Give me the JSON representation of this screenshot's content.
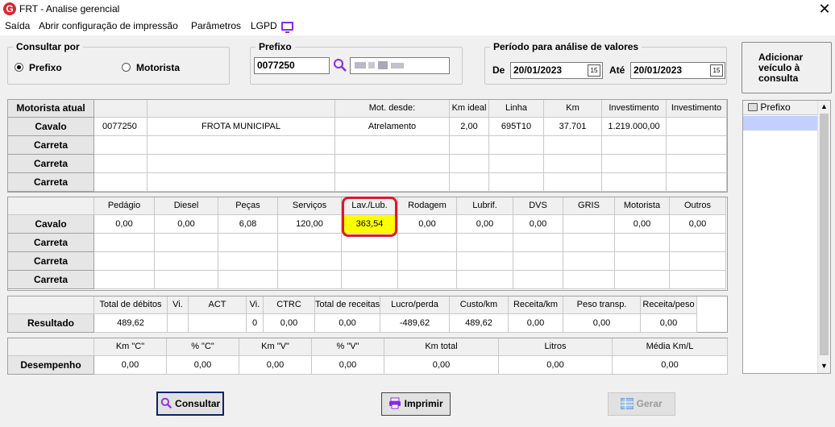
{
  "window": {
    "title": "FRT - Analise gerencial",
    "logo": "G"
  },
  "menu": [
    "Saída",
    "Abrir configuração de impressão",
    "Parâmetros",
    "LGPD"
  ],
  "consultar": {
    "legend": "Consultar por",
    "opt1": "Prefixo",
    "opt2": "Motorista"
  },
  "prefixo": {
    "legend": "Prefixo",
    "value": "0077250"
  },
  "periodo": {
    "legend": "Período para análise de valores",
    "de_label": "De",
    "de": "20/01/2023",
    "ate_label": "Até",
    "ate": "20/01/2023",
    "cal": "15"
  },
  "add_button": "Adicionar veículo à consulta",
  "side_list": {
    "header": "Prefixo"
  },
  "grid1": {
    "headers": [
      "Motorista atual",
      "",
      "",
      "Mot. desde:",
      "Km ideal",
      "Linha",
      "Km",
      "Investimento",
      "Investimento"
    ],
    "rows": [
      [
        "Cavalo",
        "0077250",
        "FROTA MUNICIPAL",
        "Atrelamento",
        "2,00",
        "695T10",
        "37.701",
        "1.219.000,00",
        ""
      ],
      [
        "Carreta",
        "",
        "",
        "",
        "",
        "",
        "",
        "",
        ""
      ],
      [
        "Carreta",
        "",
        "",
        "",
        "",
        "",
        "",
        "",
        ""
      ],
      [
        "Carreta",
        "",
        "",
        "",
        "",
        "",
        "",
        "",
        ""
      ]
    ]
  },
  "grid2": {
    "headers": [
      "",
      "Pedágio",
      "Diesel",
      "Peças",
      "Serviços",
      "Lav./Lub.",
      "Rodagem",
      "Lubrif.",
      "DVS",
      "GRIS",
      "Motorista",
      "Outros"
    ],
    "rows": [
      [
        "Cavalo",
        "0,00",
        "0,00",
        "6,08",
        "120,00",
        "363,54",
        "0,00",
        "0,00",
        "0,00",
        "",
        "0,00",
        "0,00"
      ],
      [
        "Carreta",
        "",
        "",
        "",
        "",
        "",
        "",
        "",
        "",
        "",
        "",
        ""
      ],
      [
        "Carreta",
        "",
        "",
        "",
        "",
        "",
        "",
        "",
        "",
        "",
        "",
        ""
      ],
      [
        "Carreta",
        "",
        "",
        "",
        "",
        "",
        "",
        "",
        "",
        "",
        "",
        ""
      ]
    ]
  },
  "grid3": {
    "headers": [
      "",
      "Total de débitos",
      "Vi.",
      "ACT",
      "Vi.",
      "CTRC",
      "Total de receitas",
      "Lucro/perda",
      "Custo/km",
      "Receita/km",
      "Peso transp.",
      "Receita/peso"
    ],
    "row": [
      "Resultado",
      "489,62",
      "",
      "",
      "0",
      "0,00",
      "0,00",
      "-489,62",
      "489,62",
      "0,00",
      "0,00",
      "0,00"
    ]
  },
  "grid4": {
    "headers": [
      "",
      "Km \"C\"",
      "% \"C\"",
      "Km \"V\"",
      "% \"V\"",
      "Km total",
      "Litros",
      "Média Km/L"
    ],
    "row": [
      "Desempenho",
      "0,00",
      "0,00",
      "0,00",
      "0,00",
      "0,00",
      "0,00",
      "0,00"
    ]
  },
  "buttons": {
    "consultar": "Consultar",
    "imprimir": "Imprimir",
    "gerar": "Gerar"
  },
  "colors": {
    "highlight": "#ffff00",
    "ring": "#e0182b",
    "accent": "#8a2be2"
  }
}
